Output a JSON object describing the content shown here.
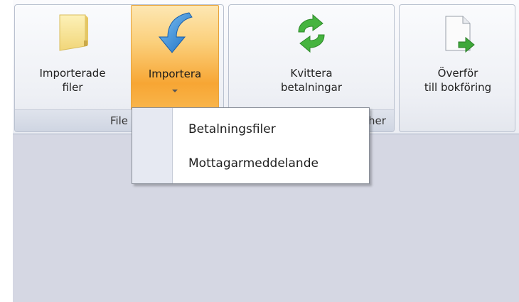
{
  "ribbon": {
    "groups": [
      {
        "label": "File"
      },
      {
        "label": "her"
      },
      {
        "label": ""
      }
    ],
    "buttons": {
      "imported_files": {
        "line1": "Importerade",
        "line2": "filer",
        "icon": "folder-icon"
      },
      "import": {
        "line1": "Importera",
        "icon": "import-arrow-icon",
        "active": true
      },
      "acknowledge": {
        "line1": "Kvittera",
        "line2": "betalningar",
        "icon": "refresh-icon"
      },
      "transfer": {
        "line1": "Överför",
        "line2": "till bokföring",
        "icon": "document-export-icon"
      }
    }
  },
  "import_menu": {
    "items": [
      {
        "label": "Betalningsfiler"
      },
      {
        "label": "Mottagarmeddelande"
      }
    ]
  },
  "colors": {
    "active_button": "#f7a634",
    "workspace": "#d5d7e3",
    "import_arrow": "#2d86d6",
    "refresh_green": "#3fa83a"
  }
}
